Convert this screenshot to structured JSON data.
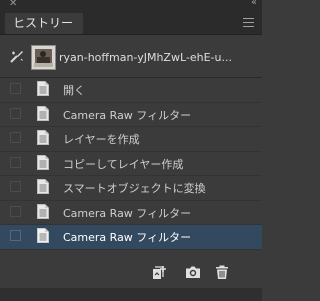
{
  "panel": {
    "tab_label": "ヒストリー"
  },
  "snapshot": {
    "label": "ryan-hoffman-yJMhZwL-ehE-u..."
  },
  "history_items": [
    {
      "label": "開く",
      "selected": false
    },
    {
      "label": "Camera Raw フィルター",
      "selected": false
    },
    {
      "label": "レイヤーを作成",
      "selected": false
    },
    {
      "label": "コピーしてレイヤー作成",
      "selected": false
    },
    {
      "label": "スマートオブジェクトに変換",
      "selected": false
    },
    {
      "label": "Camera Raw フィルター",
      "selected": false
    },
    {
      "label": "Camera Raw フィルター",
      "selected": true
    }
  ],
  "icons": {
    "close": "close-icon",
    "collapse": "double-chevron-icon",
    "panel_menu": "hamburger-menu-icon",
    "history_brush": "history-brush-icon",
    "step_document": "document-icon",
    "new_document": "new-document-from-state-icon",
    "snapshot": "camera-icon",
    "delete": "trash-icon"
  },
  "colors": {
    "panel_bg": "#3b3b3b",
    "selected_row": "#33495f",
    "header_bg": "#2b2b2b"
  }
}
